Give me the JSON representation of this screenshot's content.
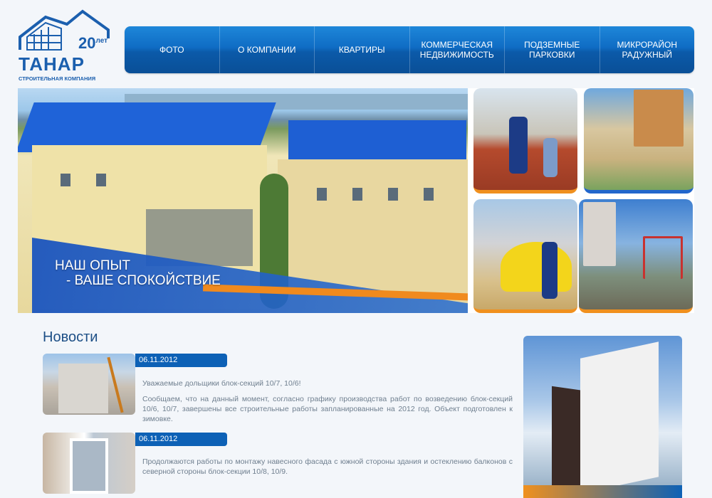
{
  "logo": {
    "years_number": "20",
    "years_suffix": "лет",
    "brand": "ТАНАР",
    "tagline": "СТРОИТЕЛЬНАЯ КОМПАНИЯ"
  },
  "nav": [
    {
      "label": "ФОТО"
    },
    {
      "label": "О КОМПАНИИ"
    },
    {
      "label": "КВАРТИРЫ"
    },
    {
      "label": "КОММЕРЧЕСКАЯ\nНЕДВИЖИМОСТЬ"
    },
    {
      "label": "ПОДЗЕМНЫЕ\nПАРКОВКИ"
    },
    {
      "label": "МИКРОРАЙОН\nРАДУЖНЫЙ"
    }
  ],
  "banner": {
    "slogan_line1": "НАШ ОПЫТ",
    "slogan_line2": "- ВАШЕ СПОКОЙСТВИЕ"
  },
  "news": {
    "title": "Новости",
    "items": [
      {
        "date": "06.11.2012",
        "heading": "Уважаемые дольщики блок-секций 10/7, 10/6!",
        "body": "Сообщаем, что на данный момент,  согласно графику производства работ по возведению блок-секций 10/6, 10/7, завершены все  строительные работы запланированные на 2012 год. Объект подготовлен к зимовке."
      },
      {
        "date": "06.11.2012",
        "heading": "",
        "body": "Продолжаются работы по монтажу навесного фасада с южной стороны здания и остеклению балконов с северной стороны блок-секции 10/8, 10/9."
      }
    ]
  }
}
